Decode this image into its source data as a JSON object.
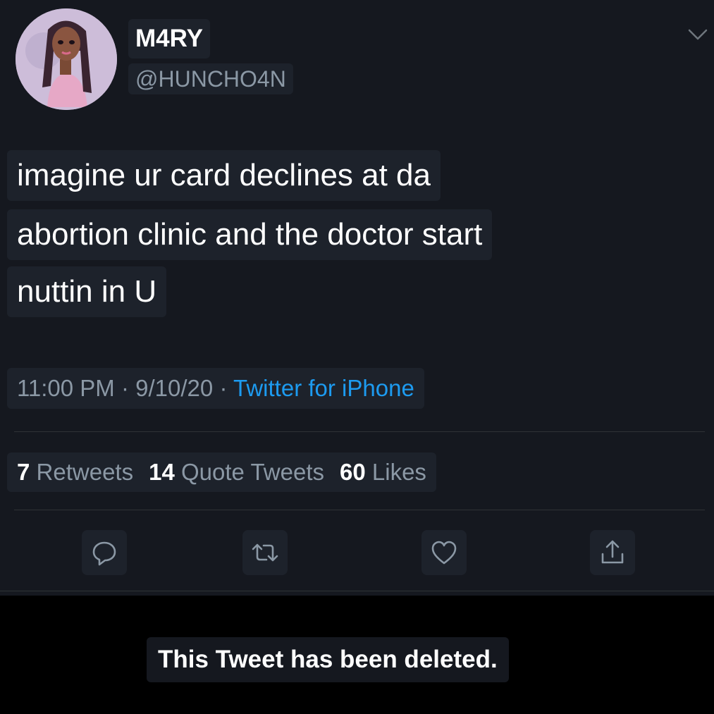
{
  "user": {
    "display_name": "M4RY",
    "handle": "@HUNCHO4N"
  },
  "tweet": {
    "lines": [
      "imagine ur card declines at da",
      "abortion clinic and the doctor start",
      "nuttin in U"
    ],
    "time": "11:00 PM",
    "date": "9/10/20",
    "separator": "·",
    "source": "Twitter for iPhone"
  },
  "stats": {
    "retweets_count": "7",
    "retweets_label": "Retweets",
    "quotes_count": "14",
    "quotes_label": "Quote Tweets",
    "likes_count": "60",
    "likes_label": "Likes"
  },
  "actions": [
    "reply-icon",
    "retweet-icon",
    "like-icon",
    "share-icon"
  ],
  "deleted_notice": "This Tweet has been deleted.",
  "colors": {
    "background": "#15181f",
    "primary_text": "#ffffff",
    "secondary_text": "#8b98a5",
    "link": "#1d9bf0"
  }
}
